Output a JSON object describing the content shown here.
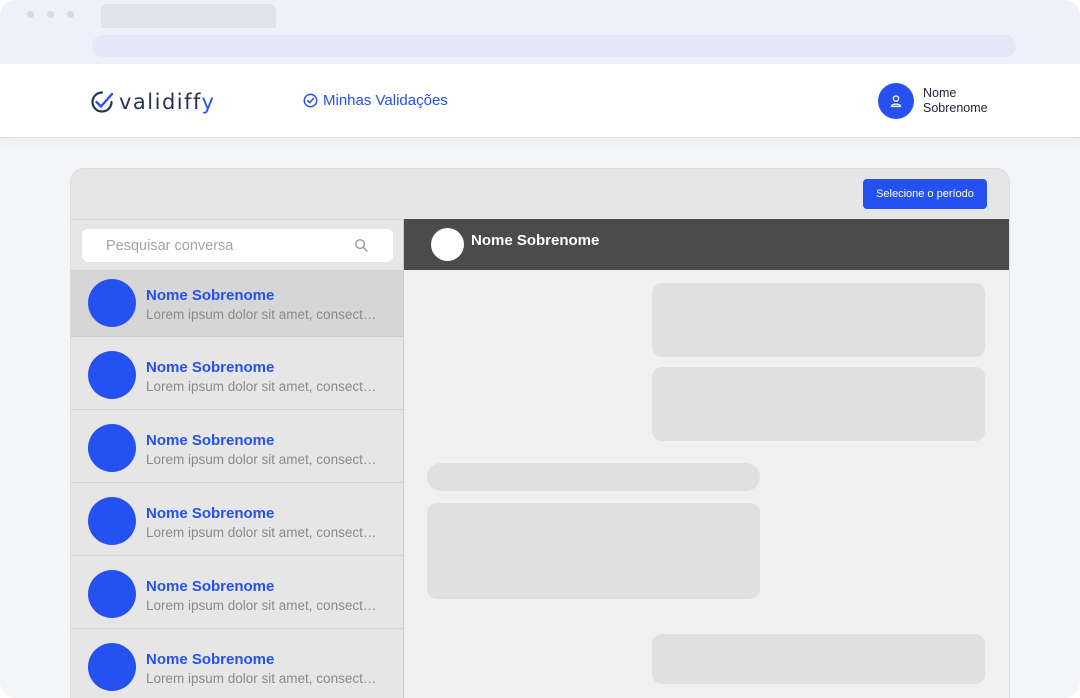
{
  "app": {
    "logo_text": "validiff",
    "logo_tail": "y",
    "colors": {
      "primary": "#2451f0",
      "header_dark": "#4b4b4b"
    }
  },
  "nav": {
    "validations_label": "Minhas Validações",
    "validations_icon": "check-circle-icon"
  },
  "user": {
    "first_name": "Nome",
    "last_name": "Sobrenome",
    "icon": "user-icon"
  },
  "toolbar": {
    "period_button_label": "Selecione o período"
  },
  "search": {
    "placeholder": "Pesquisar conversa",
    "value": "",
    "icon": "search-icon"
  },
  "conversations": [
    {
      "name": "Nome Sobrenome",
      "preview": "Lorem ipsum dolor sit amet, consectetur",
      "active": true
    },
    {
      "name": "Nome Sobrenome",
      "preview": "Lorem ipsum dolor sit amet, consectetur",
      "active": false
    },
    {
      "name": "Nome Sobrenome",
      "preview": "Lorem ipsum dolor sit amet, consectetur",
      "active": false
    },
    {
      "name": "Nome Sobrenome",
      "preview": "Lorem ipsum dolor sit amet, consectetur",
      "active": false
    },
    {
      "name": "Nome Sobrenome",
      "preview": "Lorem ipsum dolor sit amet, consectetur",
      "active": false
    },
    {
      "name": "Nome Sobrenome",
      "preview": "Lorem ipsum dolor sit amet, consectetur",
      "active": false
    }
  ],
  "chat": {
    "contact_name": "Nome Sobrenome"
  }
}
